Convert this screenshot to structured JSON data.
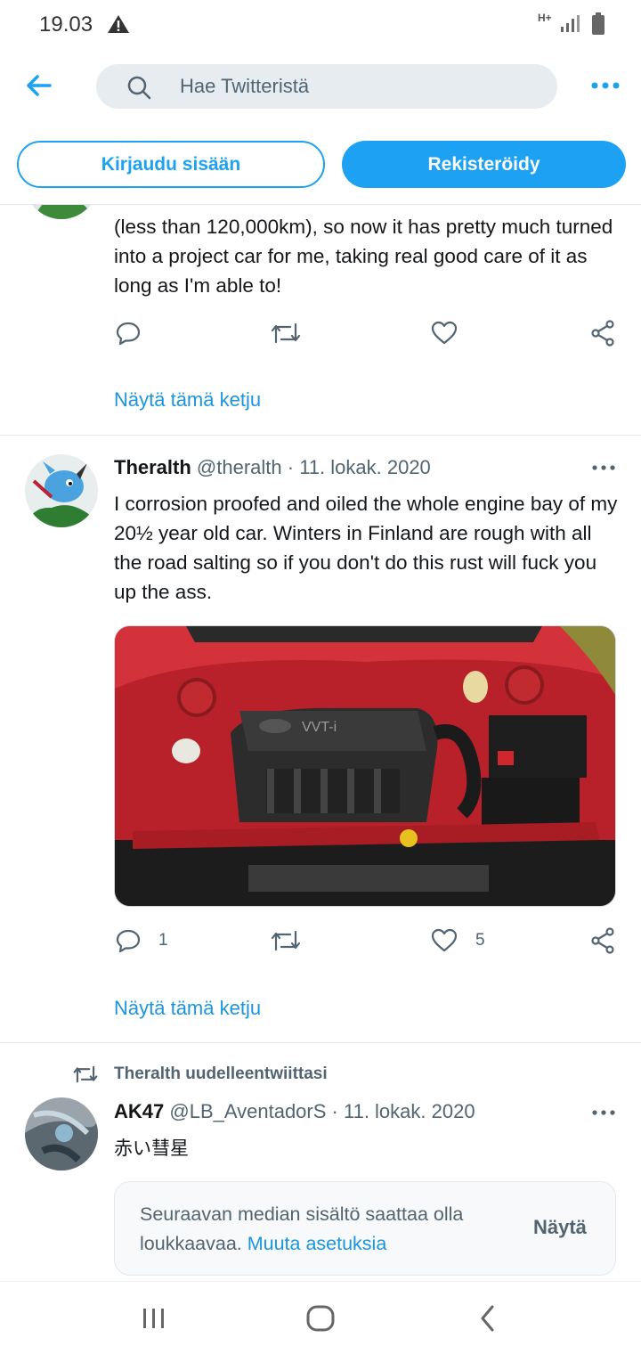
{
  "status_bar": {
    "time": "19.03",
    "network": "H+"
  },
  "search": {
    "placeholder": "Hae Twitteristä"
  },
  "auth": {
    "login_label": "Kirjaudu sisään",
    "register_label": "Rekisteröidy"
  },
  "tweets": [
    {
      "text": "(less than 120,000km), so now it has pretty much turned into a project car for me, taking real good care of it as long as I'm able to!",
      "thread_link": "Näytä tämä ketju"
    },
    {
      "name": "Theralth",
      "handle": "@theralth",
      "separator": " · ",
      "date": "11. lokak. 2020",
      "text": "I corrosion proofed and oiled the whole engine bay of my 20½ year old car. Winters in Finland are rough with all the road salting so if you don't do this rust will fuck you up the ass.",
      "reply_count": "1",
      "like_count": "5",
      "thread_link": "Näytä tämä ketju"
    },
    {
      "retweet_context": "Theralth uudelleentwiittasi",
      "name": "AK47",
      "handle": "@LB_AventadorS",
      "separator": " · ",
      "date": "11. lokak. 2020",
      "text": "赤い彗星",
      "sensitive_message": "Seuraavan median sisältö saattaa olla loukkaavaa.",
      "sensitive_link": "Muuta asetuksia",
      "show_label": "Näytä"
    }
  ],
  "colors": {
    "accent": "#1da1f2",
    "link": "#1b95e0",
    "text": "#14171a",
    "secondary": "#536471"
  }
}
